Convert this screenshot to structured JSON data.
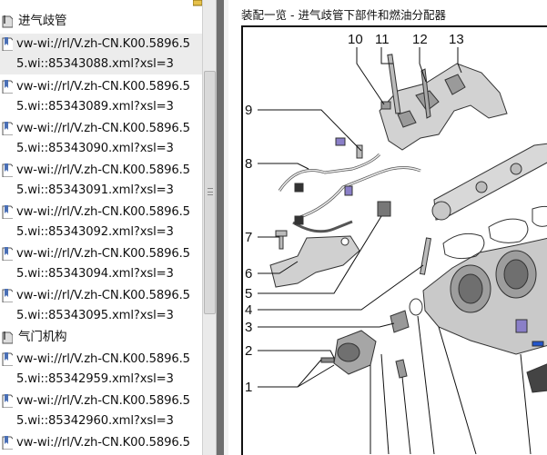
{
  "sidebar": {
    "items": [
      {
        "type": "folder",
        "text": "进气歧管",
        "selected": false
      },
      {
        "type": "link",
        "line1": "vw-wi://rl/V.zh-CN.K00.5896.5",
        "line2": "5.wi::85343088.xml?xsl=3",
        "selected": true
      },
      {
        "type": "link",
        "line1": "vw-wi://rl/V.zh-CN.K00.5896.5",
        "line2": "5.wi::85343089.xml?xsl=3",
        "selected": false
      },
      {
        "type": "link",
        "line1": "vw-wi://rl/V.zh-CN.K00.5896.5",
        "line2": "5.wi::85343090.xml?xsl=3",
        "selected": false
      },
      {
        "type": "link",
        "line1": "vw-wi://rl/V.zh-CN.K00.5896.5",
        "line2": "5.wi::85343091.xml?xsl=3",
        "selected": false
      },
      {
        "type": "link",
        "line1": "vw-wi://rl/V.zh-CN.K00.5896.5",
        "line2": "5.wi::85343092.xml?xsl=3",
        "selected": false
      },
      {
        "type": "link",
        "line1": "vw-wi://rl/V.zh-CN.K00.5896.5",
        "line2": "5.wi::85343094.xml?xsl=3",
        "selected": false
      },
      {
        "type": "link",
        "line1": "vw-wi://rl/V.zh-CN.K00.5896.5",
        "line2": "5.wi::85343095.xml?xsl=3",
        "selected": false
      },
      {
        "type": "folder",
        "text": "气门机构",
        "selected": false
      },
      {
        "type": "link",
        "line1": "vw-wi://rl/V.zh-CN.K00.5896.5",
        "line2": "5.wi::85342959.xml?xsl=3",
        "selected": false
      },
      {
        "type": "link",
        "line1": "vw-wi://rl/V.zh-CN.K00.5896.5",
        "line2": "5.wi::85342960.xml?xsl=3",
        "selected": false
      },
      {
        "type": "link",
        "line1": "vw-wi://rl/V.zh-CN.K00.5896.5",
        "line2": "",
        "selected": false
      }
    ]
  },
  "document": {
    "title": "装配一览 - 进气歧管下部件和燃油分配器",
    "callouts": {
      "c1": "1",
      "c2": "2",
      "c3": "3",
      "c4": "4",
      "c5": "5",
      "c6": "6",
      "c7": "7",
      "c8": "8",
      "c9": "9",
      "c10": "10",
      "c11": "11",
      "c12": "12",
      "c13": "13"
    }
  },
  "colors": {
    "splitter": "#6f6f6f",
    "selection": "#ececec",
    "part_accent_purple": "#8a7fc8",
    "part_accent_blue": "#2255cc"
  },
  "icons": {
    "bookmark": "bookmark-page-icon",
    "folder": "folder-open-icon",
    "options": "bookmark-options-icon"
  }
}
